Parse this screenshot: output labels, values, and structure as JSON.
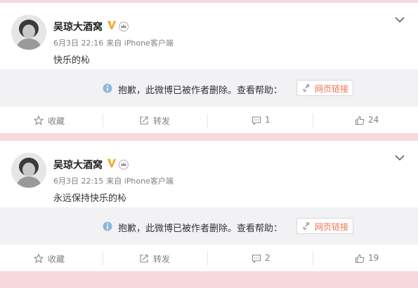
{
  "posts": [
    {
      "user": "吴琼大酒窝",
      "date": "6月3日 22:16",
      "source": "来自 iPhone客户端",
      "text": "快乐的杺",
      "deleted_notice": "抱歉，此微博已被作者删除。查看帮助：",
      "help_link": "网页链接",
      "actions": {
        "favorite": "收藏",
        "forward": "转发",
        "comments": "1",
        "likes": "24"
      }
    },
    {
      "user": "吴琼大酒窝",
      "date": "6月3日 22:15",
      "source": "来自 iPhone客户端",
      "text": "永远保持快乐的杺",
      "deleted_notice": "抱歉，此微博已被作者删除。查看帮助：",
      "help_link": "网页链接",
      "actions": {
        "favorite": "收藏",
        "forward": "转发",
        "comments": "2",
        "likes": "19"
      }
    }
  ],
  "icons": {
    "verified": "verified-v-icon",
    "member": "crown-icon",
    "menu": "chevron-down-icon",
    "info": "info-icon",
    "link": "link-icon",
    "favorite": "star-icon",
    "forward": "forward-icon",
    "comment": "comment-icon",
    "like": "thumbs-up-icon"
  },
  "colors": {
    "background": "#f7d9dd",
    "verified": "#f5a623",
    "link": "#eb7350",
    "info": "#8fb8d8"
  }
}
